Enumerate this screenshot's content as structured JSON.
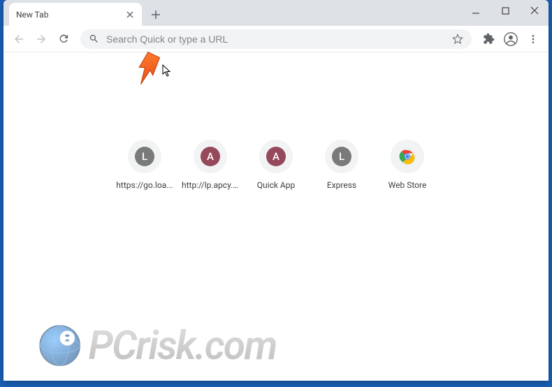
{
  "tab": {
    "title": "New Tab"
  },
  "omnibox": {
    "placeholder": "Search Quick or type a URL"
  },
  "shortcuts": [
    {
      "label": "https://go.loa...",
      "letter": "L",
      "badge_bg": "#7a7a7a"
    },
    {
      "label": "http://lp.apcy....",
      "letter": "A",
      "badge_bg": "#95495a"
    },
    {
      "label": "Quick App",
      "letter": "A",
      "badge_bg": "#95495a"
    },
    {
      "label": "Express",
      "letter": "L",
      "badge_bg": "#7a7a7a"
    },
    {
      "label": "Web Store",
      "letter": "",
      "badge_bg": "#ffffff",
      "is_webstore": true
    }
  ],
  "watermark": {
    "text": "PCrisk.com"
  }
}
